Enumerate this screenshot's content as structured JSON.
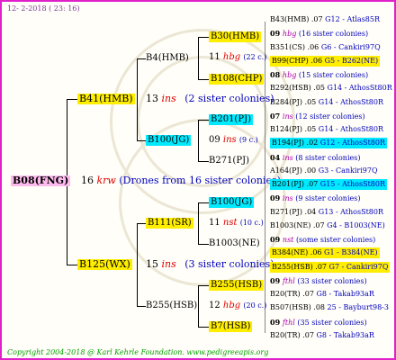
{
  "header": {
    "date": "12-  2-2018 ( 23: 16)"
  },
  "footer": {
    "text": "Copyright 2004-2018 @ Karl Kehrle Foundation.   www.pedigreeapis.org"
  },
  "root": {
    "label": "B08(FNG)",
    "gen": "16",
    "term": "krw",
    "note": "(Drones from 16 sister colonies)"
  },
  "gen1": [
    {
      "label": "B41(HMB)",
      "gen": "13",
      "term": "ins",
      "note": "(2 sister colonies)"
    },
    {
      "label": "B125(WX)",
      "gen": "15",
      "term": "ins",
      "note": "(3 sister colonies)"
    }
  ],
  "gen2": [
    {
      "label": "B4(HMB)"
    },
    {
      "label": "B100(JG)"
    },
    {
      "label": "B111(SR)",
      "gen": "11",
      "term": "nst",
      "note": "(10 c.)"
    },
    {
      "label": "B255(HSB)"
    }
  ],
  "gen3": [
    {
      "label": "B30(HMB)",
      "gen": "11",
      "term": "hbg",
      "note": "(22 c.)"
    },
    {
      "label": "B108(CHP)"
    },
    {
      "label": "B201(PJ)",
      "gen": "09",
      "term": "ins",
      "note": "(9 c.)"
    },
    {
      "label": "B271(PJ)"
    },
    {
      "label": "B100(JG)",
      "gen": "11",
      "term": "nst",
      "note": "(10 c.)"
    },
    {
      "label": "B1003(NE)"
    },
    {
      "label": "B255(HSB)",
      "gen": "12",
      "term": "hbg",
      "note": "(20 c.)"
    },
    {
      "label": "B7(HSB)"
    }
  ],
  "gen4": [
    {
      "text": "B43(HMB) .07",
      "ref": "G12 - Atlas85R"
    },
    {
      "gen": "09",
      "term": "hbg",
      "note": "(16 sister colonies)"
    },
    {
      "text": "B351(CS) .06",
      "ref": "G6 - Cankiri97Q"
    },
    {
      "text": "B99(CHP) .06",
      "ref": "G5 - B262(NE)"
    },
    {
      "gen": "08",
      "term": "hbg",
      "note": "(15 sister colonies)"
    },
    {
      "text": "B292(HSB) .05",
      "ref": "G14 - AthosSt80R"
    },
    {
      "text": "B284(PJ) .05",
      "ref": "G14 - AthosSt80R"
    },
    {
      "gen": "07",
      "term": "ins",
      "note": "(12 sister colonies)"
    },
    {
      "text": "B124(PJ) .05",
      "ref": "G14 - AthosSt80R"
    },
    {
      "text": "B194(PJ) .02",
      "ref": "G12 - AthosSt80R"
    },
    {
      "gen": "04",
      "term": "ins",
      "note": "(8 sister colonies)"
    },
    {
      "text": "A164(PJ) .00",
      "ref": "G3 - Cankiri97Q"
    },
    {
      "text": "B201(PJ) .07",
      "ref": "G15 - AthosSt80R"
    },
    {
      "gen": "09",
      "term": "ins",
      "note": "(9 sister colonies)"
    },
    {
      "text": "B271(PJ) .04",
      "ref": "G13 - AthosSt80R"
    },
    {
      "text": "B1003(NE) .07",
      "ref": "G4 - B1003(NE)"
    },
    {
      "gen": "09",
      "term": "nst",
      "note": "(some sister colonies)"
    },
    {
      "text": "B384(NE) .06",
      "ref": "G1 - B384(NE)"
    },
    {
      "text": "B255(HSB) .07",
      "ref": "G7 - Cankiri97Q"
    },
    {
      "gen": "09",
      "term": "fthl",
      "note": "(33 sister colonies)"
    },
    {
      "text": "B20(TR) .07",
      "ref": "G8 - Takab93aR"
    },
    {
      "text": "B507(HSB) .08",
      "ref": "25 - Bayburt98-3"
    },
    {
      "gen": "09",
      "term": "fthl",
      "note": "(35 sister colonies)"
    },
    {
      "text": "B20(TR) .07",
      "ref": "G8 - Takab93aR"
    }
  ],
  "colors": {
    "border": "#e020c8",
    "yellow": "#ffee00",
    "cyan": "#00eaff",
    "pink": "#ffbbee",
    "red": "#e00000",
    "magenta": "#aa00aa",
    "blue": "#0000bb"
  }
}
